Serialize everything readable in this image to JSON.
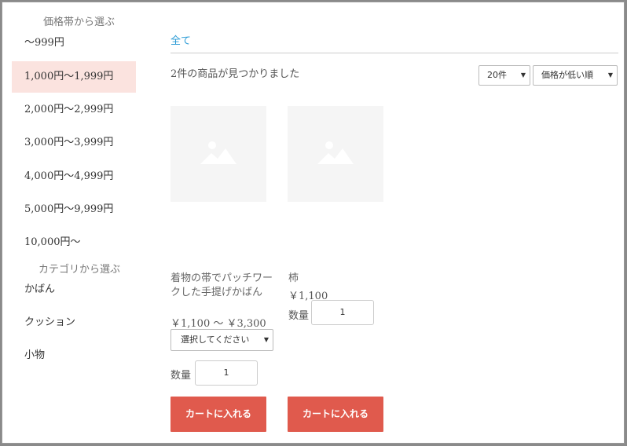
{
  "sidebar": {
    "price_heading": "価格帯から選ぶ",
    "price_items": [
      {
        "label": "～999円"
      },
      {
        "label": "1,000円～1,999円"
      },
      {
        "label": "2,000円～2,999円"
      },
      {
        "label": "3,000円～3,999円"
      },
      {
        "label": "4,000円～4,999円"
      },
      {
        "label": "5,000円～9,999円"
      },
      {
        "label": "10,000円～"
      }
    ],
    "category_heading": "カテゴリから選ぶ",
    "category_items": [
      {
        "label": "かばん"
      },
      {
        "label": "クッション"
      },
      {
        "label": "小物"
      }
    ]
  },
  "main": {
    "breadcrumb": "全て",
    "result_text": "2件の商品が見つかりました",
    "per_page": "20件",
    "sort": "価格が低い順"
  },
  "products": [
    {
      "name": "着物の帯でパッチワークした手提げかばん",
      "price": "￥1,100 ～ ￥3,300",
      "variant_placeholder": "選択してください",
      "qty_label": "数量",
      "qty": "1",
      "cart_label": "カートに入れる"
    },
    {
      "name": "柿",
      "price": "￥1,100",
      "qty_label": "数量",
      "qty": "1",
      "cart_label": "カートに入れる"
    }
  ],
  "colors": {
    "accent": "#e05a4d",
    "active_bg": "#fbe3df",
    "link": "#2a9bd6"
  }
}
